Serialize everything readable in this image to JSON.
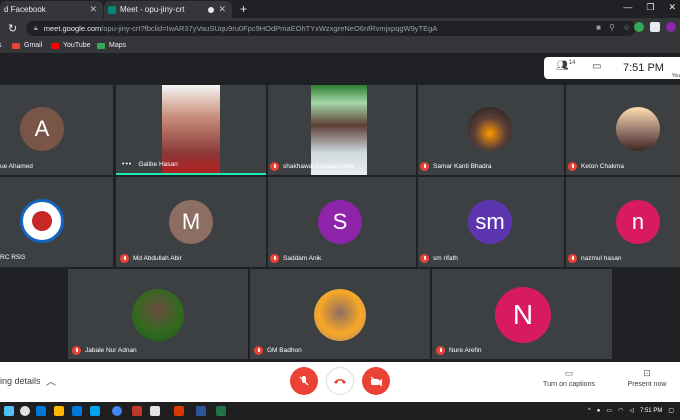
{
  "browser": {
    "tabs": [
      {
        "title": "d Facebook",
        "active": false
      },
      {
        "title": "Meet - opu-jiny-crt",
        "active": true
      }
    ],
    "new_tab": "+",
    "url_host": "meet.google.com",
    "url_path": "/opu-jiny-crt?fbclid=IwAR37yVauSUqu9ru0Fpc9HOdPmaEOhTYxWzxgreNeO6nfRvmjxpqgW9yTEgA",
    "bookmarks": [
      {
        "label": "s",
        "color": "#fbbc04"
      },
      {
        "label": "Gmail",
        "color": "#ea4335"
      },
      {
        "label": "YouTube",
        "color": "#ff0000"
      },
      {
        "label": "Maps",
        "color": "#34a853"
      }
    ]
  },
  "meet": {
    "participants_count": "14",
    "time": "7:51 PM",
    "you_label": "You",
    "tiles": [
      {
        "name": "ue Ahamed",
        "initial": "A",
        "avatar_color": "#795548",
        "muted": false
      },
      {
        "name": "Galibe Hasan",
        "initial": "",
        "avatar_color": "#a1887f",
        "muted": false,
        "speaking": true
      },
      {
        "name": "shakhawat hossain ridoy",
        "initial": "",
        "avatar_color": "#37474f",
        "muted": true
      },
      {
        "name": "Samar Kanti Bhadra",
        "initial": "",
        "avatar_color": "#4e342e",
        "muted": true
      },
      {
        "name": "Keton Chakma",
        "initial": "",
        "avatar_color": "#8d6e63",
        "muted": true
      },
      {
        "name": "RC RSG",
        "initial": "",
        "avatar_color": "#ffffff",
        "muted": false
      },
      {
        "name": "Md Abdullah Abir",
        "initial": "M",
        "avatar_color": "#8d6e63",
        "muted": true
      },
      {
        "name": "Saddam Anik",
        "initial": "S",
        "avatar_color": "#8e24aa",
        "muted": true
      },
      {
        "name": "sm rifath",
        "initial": "sm",
        "avatar_color": "#5e35b1",
        "muted": true
      },
      {
        "name": "nazmul hasan",
        "initial": "n",
        "avatar_color": "#d81b60",
        "muted": true
      },
      {
        "name": "Jabale Nur Adnan",
        "initial": "",
        "avatar_color": "#558b2f",
        "muted": true
      },
      {
        "name": "GM Badhon",
        "initial": "",
        "avatar_color": "#f9a825",
        "muted": true
      },
      {
        "name": "Nure Arefin",
        "initial": "N",
        "avatar_color": "#d81b60",
        "muted": true
      }
    ],
    "meeting_details": "ing details",
    "turn_on_captions": "Turn on captions",
    "present_now": "Present now"
  },
  "taskbar": {
    "time": "7:51 PM",
    "icon_colors": [
      "#0078d7",
      "#ffb900",
      "#0078d7",
      "#00a4ef",
      "#e3e3e3",
      "#4285f4",
      "#c0392b",
      "#d83b01",
      "#2b579a",
      "#217346",
      "#0078d7"
    ]
  }
}
